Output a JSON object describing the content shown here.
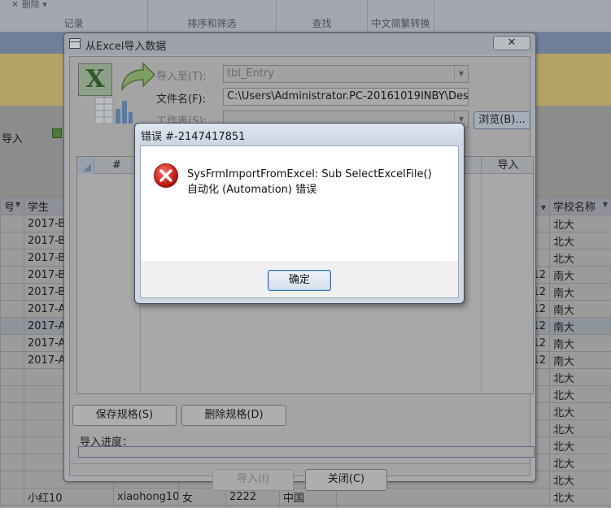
{
  "ribbon": {
    "groups": [
      {
        "top_text": "✕ 删除 ▾",
        "label": "记录"
      },
      {
        "top_text": "",
        "label": "排序和筛选"
      },
      {
        "top_text": "",
        "label": "查找"
      },
      {
        "top_text": "",
        "label": "中文简繁转换"
      }
    ]
  },
  "background": {
    "import_label": "导入",
    "grid": {
      "headers": [
        "号",
        "学生",
        "",
        "",
        "",
        "",
        "",
        "学校名称"
      ],
      "rows": [
        [
          "",
          "2017-B",
          "",
          "",
          "",
          "",
          "",
          "北大"
        ],
        [
          "",
          "2017-B",
          "",
          "",
          "",
          "",
          "",
          "北大"
        ],
        [
          "",
          "2017-B",
          "",
          "",
          "",
          "",
          "",
          "北大"
        ],
        [
          "",
          "2017-B",
          "",
          "",
          "",
          "",
          "12",
          "南大"
        ],
        [
          "",
          "2017-B",
          "",
          "",
          "",
          "",
          "12",
          "南大"
        ],
        [
          "",
          "2017-A",
          "",
          "",
          "",
          "",
          "12",
          "南大"
        ],
        [
          "",
          "2017-A",
          "",
          "",
          "",
          "",
          "12",
          "南大"
        ],
        [
          "",
          "2017-A",
          "",
          "",
          "",
          "",
          "12",
          "南大"
        ],
        [
          "",
          "2017-A",
          "",
          "",
          "",
          "",
          "12",
          "南大"
        ],
        [
          "",
          "",
          "",
          "",
          "",
          "",
          "",
          "北大"
        ],
        [
          "",
          "",
          "",
          "",
          "",
          "",
          "",
          "北大"
        ],
        [
          "",
          "",
          "",
          "",
          "",
          "",
          "",
          "北大"
        ],
        [
          "",
          "",
          "",
          "",
          "",
          "",
          "",
          "北大"
        ],
        [
          "",
          "",
          "",
          "",
          "",
          "",
          "",
          "北大"
        ],
        [
          "",
          "",
          "",
          "",
          "",
          "",
          "",
          "北大"
        ],
        [
          "",
          "",
          "",
          "",
          "",
          "",
          "",
          "北大"
        ],
        [
          "",
          "小红10",
          "xiaohong10",
          "女",
          "2222",
          "中国",
          "",
          "北大"
        ]
      ]
    }
  },
  "import_dialog": {
    "title": "从Excel导入数据",
    "close_label": "✕",
    "import_to_label": "导入至(T):",
    "import_to_value": "tbl_Entry",
    "filename_label": "文件名(F):",
    "filename_value": "C:\\Users\\Administrator.PC-20161019INBY\\Deskt",
    "browse_label": "浏览(B)...",
    "sheet_label": "工作表(S):",
    "sheet_value": "",
    "preview_num_header": "#",
    "preview_import_header": "导入",
    "save_spec_label": "保存规格(S)",
    "delete_spec_label": "删除规格(D)",
    "progress_label": "导入进度：",
    "progress_fraction": 0,
    "import_button_label": "导入(I)",
    "close_button_label": "关闭(C)"
  },
  "error_box": {
    "title": "错误 #-2147417851",
    "message_line1": "SysFrmImportFromExcel: Sub SelectExcelFile()",
    "message_line2": "自动化 (Automation) 错误",
    "ok_label": "确定",
    "icon": "error-icon"
  }
}
